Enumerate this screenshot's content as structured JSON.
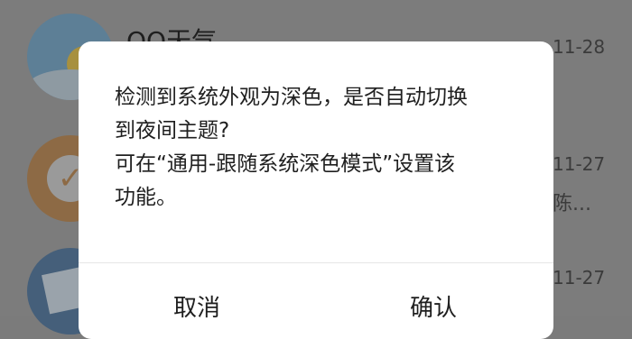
{
  "background_list": {
    "items": [
      {
        "title": "QQ天气",
        "date": "11-28"
      },
      {
        "title": "",
        "date": "11-27",
        "subtitle": "陈..."
      },
      {
        "title": "",
        "date": "11-27"
      }
    ]
  },
  "dialog": {
    "message_lines": [
      "检测到系统外观为深色，是否自动切换",
      "到夜间主题?",
      "可在“通用-跟随系统深色模式”设置该",
      "功能。"
    ],
    "cancel_label": "取消",
    "confirm_label": "确认"
  },
  "colors": {
    "overlay": "#7b7b7b",
    "dialog_bg": "#ffffff",
    "text": "#1f1f1f"
  }
}
